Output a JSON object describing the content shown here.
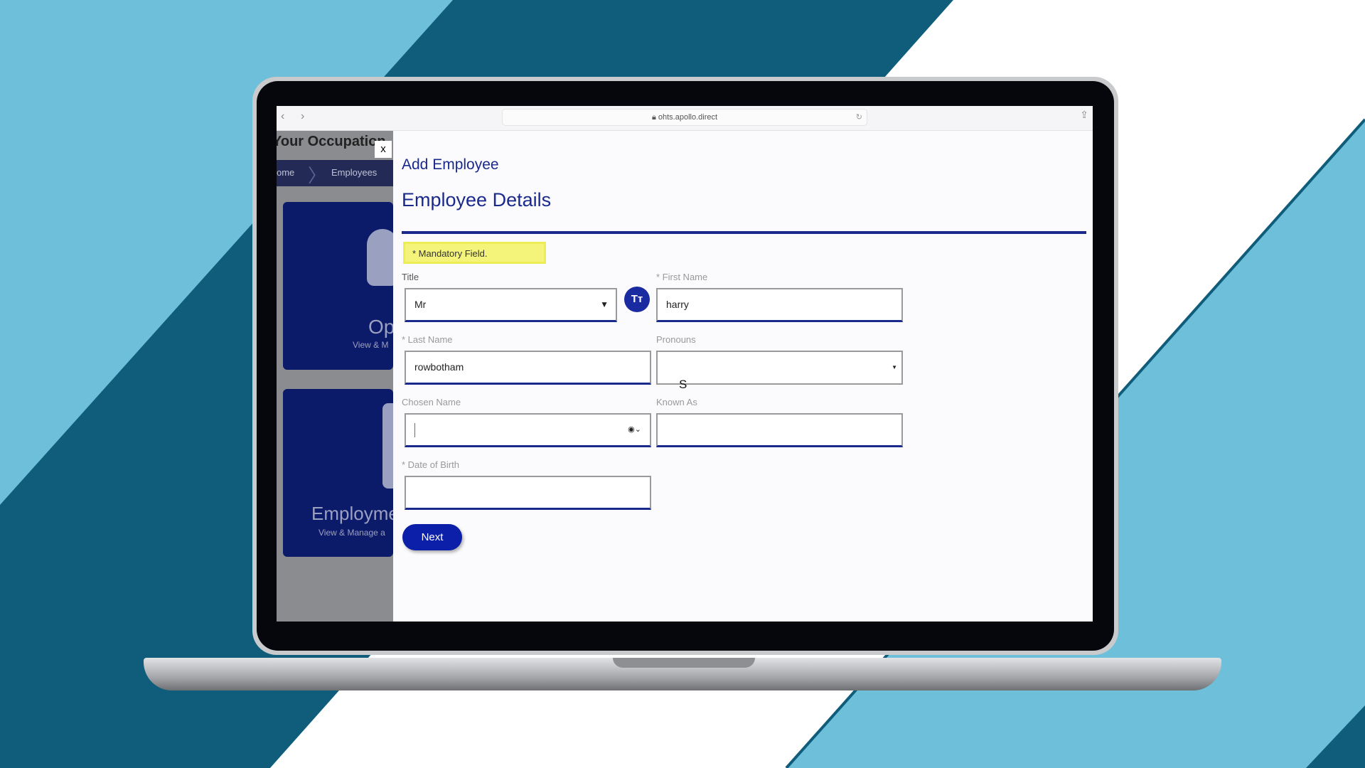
{
  "colors": {
    "background_light": "#6ebfda",
    "background_dark": "#0f5c7b",
    "accent": "#1a2a8c",
    "button": "#0b1fa8",
    "mandatory_bg": "#f4f47a"
  },
  "browser": {
    "url": "ohts.apollo.direct",
    "back_icon": "chevron-left",
    "forward_icon": "chevron-right",
    "reload_icon": "reload",
    "share_icon": "share"
  },
  "background_app": {
    "title": "Your Occupation",
    "close_label": "x",
    "breadcrumb": [
      "ome",
      "Employees"
    ],
    "cards": [
      {
        "title": "Op",
        "subtitle": "View & M"
      },
      {
        "title": "Employme",
        "subtitle": "View & Manage a"
      }
    ]
  },
  "modal": {
    "heading": "Add Employee",
    "section": "Employee Details",
    "mandatory_note": "* Mandatory Field.",
    "fields": {
      "title": {
        "label": "Title",
        "value": "Mr"
      },
      "first_name": {
        "label": "* First Name",
        "value": "harry"
      },
      "last_name": {
        "label": "* Last Name",
        "value": "rowbotham"
      },
      "pronouns": {
        "label": "Pronouns",
        "value": ""
      },
      "chosen_name": {
        "label": "Chosen Name",
        "value": ""
      },
      "known_as": {
        "label": "Known As",
        "value": ""
      },
      "dob": {
        "label": "* Date of Birth",
        "value": ""
      }
    },
    "text_size_button": "Tт",
    "next_label": "Next",
    "cursor_glyph": "S"
  }
}
